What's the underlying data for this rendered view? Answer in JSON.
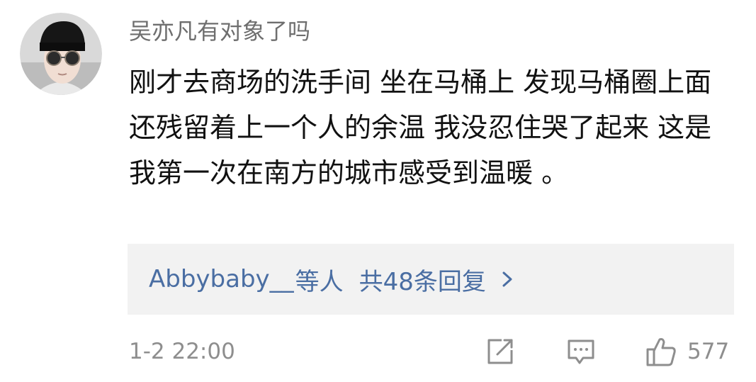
{
  "comment": {
    "username": "吴亦凡有对象了吗",
    "text": "刚才去商场的洗手间 坐在马桶上 发现马桶圈上面还残留着上一个人的余温 我没忍住哭了起来 这是我第一次在南方的城市感受到温暖 。",
    "replies": {
      "user": "Abbybaby__",
      "suffix": "等人",
      "count_text": "共48条回复"
    },
    "timestamp": "1-2 22:00",
    "like_count": "577",
    "icons": {
      "avatar": "user-avatar",
      "share": "share-icon",
      "comment": "comment-icon",
      "like": "thumbs-up-icon",
      "chevron": "chevron-right-icon"
    },
    "colors": {
      "link": "#4a6ea3",
      "muted": "#8e8e8e",
      "text": "#111111",
      "replies_bg": "#f2f2f2"
    }
  }
}
